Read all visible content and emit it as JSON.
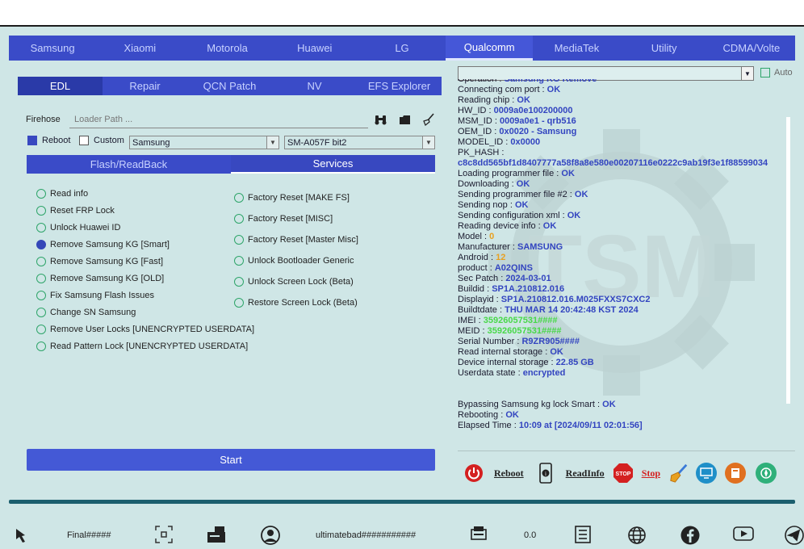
{
  "main_tabs": [
    "Samsung",
    "Xiaomi",
    "Motorola",
    "Huawei",
    "LG",
    "Qualcomm",
    "MediaTek",
    "Utility",
    "CDMA/Volte"
  ],
  "sub_tabs": [
    "EDL",
    "Repair",
    "QCN Patch",
    "NV",
    "EFS Explorer"
  ],
  "firehose": {
    "label": "Firehose",
    "placeholder": "Loader Path ..."
  },
  "options": {
    "reboot_label": "Reboot",
    "custom_label": "Custom",
    "brand_select": "Samsung",
    "model_select": "SM-A057F bit2"
  },
  "mode_tabs": [
    "Flash/ReadBack",
    "Services"
  ],
  "services_left": [
    "Read info",
    "Reset FRP Lock",
    "Unlock Huawei ID",
    "Remove Samsung KG [Smart]",
    "Remove Samsung KG [Fast]",
    "Remove Samsung KG [OLD]",
    "Fix Samsung Flash Issues",
    "Change SN Samsung",
    "Remove User Locks [UNENCRYPTED USERDATA]",
    "Read Pattern Lock [UNENCRYPTED USERDATA]"
  ],
  "services_right": [
    "Factory Reset [MAKE FS]",
    "Factory Reset [MISC]",
    "Factory Reset [Master Misc]",
    "Unlock Bootloader Generic",
    "Unlock Screen Lock (Beta)",
    "Restore Screen Lock (Beta)"
  ],
  "selected_service": "Remove Samsung KG [Smart]",
  "start_label": "Start",
  "auto_label": "Auto",
  "watermark": "TSM",
  "log": [
    {
      "k": "Operation : ",
      "v": "Samsung KG Remove"
    },
    {
      "k": "Connecting com port : ",
      "v": "OK"
    },
    {
      "k": "Reading chip : ",
      "v": "OK"
    },
    {
      "k": "HW_ID : ",
      "v": "0009a0e100200000"
    },
    {
      "k": "MSM_ID : ",
      "v": "0009a0e1 - qrb516"
    },
    {
      "k": "OEM_ID : ",
      "v": "0x0020 - Samsung"
    },
    {
      "k": "MODEL_ID : ",
      "v": "0x0000"
    },
    {
      "k": "PK_HASH : ",
      "v": ""
    },
    {
      "k": "",
      "v": "c8c8dd565bf1d8407777a58f8a8e580e00207116e0222c9ab19f3e1f88599034",
      "wrap": true
    },
    {
      "k": "Loading programmer file : ",
      "v": "OK"
    },
    {
      "k": "Downloading : ",
      "v": "OK"
    },
    {
      "k": "Sending programmer file #2 : ",
      "v": "OK"
    },
    {
      "k": "Sending nop : ",
      "v": "OK"
    },
    {
      "k": "Sending configuration xml : ",
      "v": "OK"
    },
    {
      "k": "Reading device info : ",
      "v": "OK"
    },
    {
      "k": "Model : ",
      "v": "0",
      "c": "orange"
    },
    {
      "k": "Manufacturer : ",
      "v": "SAMSUNG"
    },
    {
      "k": "Android : ",
      "v": "12",
      "c": "orange"
    },
    {
      "k": "product : ",
      "v": "A02QINS"
    },
    {
      "k": "Sec Patch : ",
      "v": "2024-03-01"
    },
    {
      "k": "Buildid : ",
      "v": "SP1A.210812.016"
    },
    {
      "k": "Displayid : ",
      "v": "SP1A.210812.016.M025FXXS7CXC2"
    },
    {
      "k": "Buildtdate : ",
      "v": "THU MAR 14 20:42:48 KST 2024"
    },
    {
      "k": "IMEI : ",
      "v": "35926057531####",
      "c": "green"
    },
    {
      "k": "MEID : ",
      "v": "35926057531####",
      "c": "green"
    },
    {
      "k": "Serial Number : ",
      "v": "R9ZR905####"
    },
    {
      "k": "Read internal storage : ",
      "v": "OK"
    },
    {
      "k": "Device internal storage : ",
      "v": "22.85 GB"
    },
    {
      "k": "Userdata state : ",
      "v": "encrypted"
    },
    {
      "k": "",
      "v": ""
    },
    {
      "k": "",
      "v": ""
    },
    {
      "k": "Bypassing Samsung kg lock Smart : ",
      "v": "OK"
    },
    {
      "k": "Rebooting : ",
      "v": "OK"
    },
    {
      "k": "Elapsed Time : ",
      "v": "10:09 at [2024/09/11 02:01:56]"
    }
  ],
  "actions": {
    "reboot": "Reboot",
    "readinfo": "ReadInfo",
    "stop": "Stop",
    "stop_sign": "STOP"
  },
  "status": {
    "final": "Final#####",
    "user": "ultimatebad###########",
    "value": "0.0"
  },
  "colors": {
    "accent": "#3a4bc8",
    "bg": "#cfe6e6",
    "log_value": "#3345c0",
    "log_green": "#48d848",
    "log_orange": "#e8a020",
    "reboot_red": "#d42020"
  }
}
